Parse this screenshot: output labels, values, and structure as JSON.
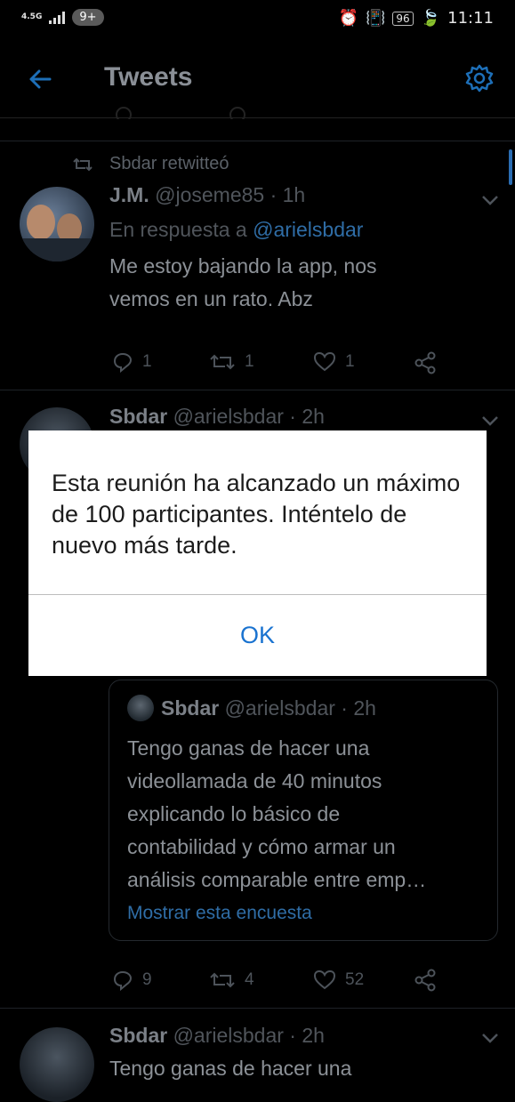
{
  "status_bar": {
    "network": "4.5G",
    "notif_count": "9+",
    "battery": "96",
    "time": "11:11"
  },
  "header": {
    "title": "Tweets"
  },
  "tweet1": {
    "retweet_label": "Sbdar retwitteó",
    "name": "J.M.",
    "handle": "@joseme85 · 1h",
    "reply_prefix": "En respuesta a ",
    "reply_to": "@arielsbdar",
    "text_line1": "Me estoy bajando la app, nos",
    "text_line2": "vemos en un rato. Abz",
    "replies": "1",
    "retweets": "1",
    "likes": "1"
  },
  "tweet2": {
    "name": "Sbdar",
    "handle": "@arielsbdar · 2h",
    "replies": "9",
    "retweets": "4",
    "likes": "52",
    "quote": {
      "name": "Sbdar",
      "handle": "@arielsbdar · 2h",
      "line1": "Tengo ganas de hacer una",
      "line2": "videollamada de 40 minutos",
      "line3": "explicando lo básico de",
      "line4": "contabilidad y cómo armar un",
      "line5": "análisis comparable entre emp…",
      "link": "Mostrar esta encuesta"
    }
  },
  "tweet3": {
    "name": "Sbdar",
    "handle": "@arielsbdar · 2h",
    "text_partial": "Tengo ganas de hacer una"
  },
  "dialog": {
    "message": "Esta reunión ha alcanzado un máximo de 100 participantes. Inténtelo de nuevo más tarde.",
    "ok_label": "OK"
  }
}
